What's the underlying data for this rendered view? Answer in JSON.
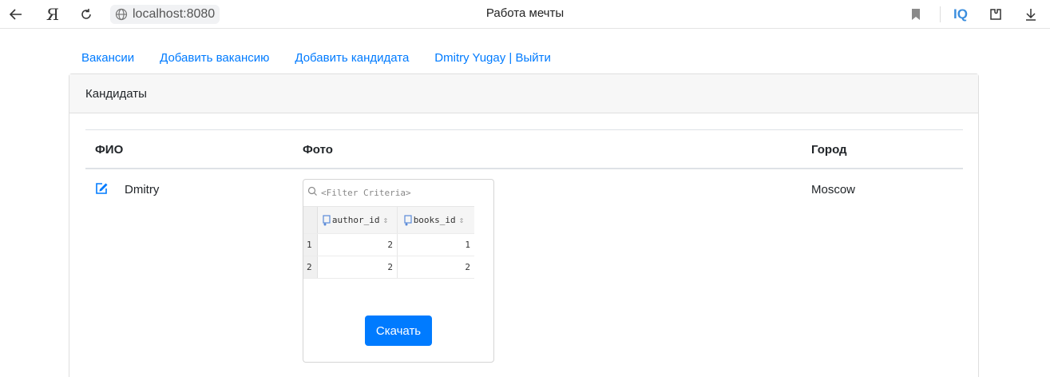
{
  "browser": {
    "address": "localhost:8080",
    "title": "Работа мечты",
    "ya_label": "Я",
    "iq_label": "IQ"
  },
  "nav": {
    "items": [
      {
        "label": "Вакансии"
      },
      {
        "label": "Добавить вакансию"
      },
      {
        "label": "Добавить кандидата"
      },
      {
        "label": "Dmitry Yugay | Выйти"
      }
    ]
  },
  "card": {
    "header": "Кандидаты",
    "columns": {
      "name": "ФИО",
      "photo": "Фото",
      "city": "Город"
    },
    "rows": [
      {
        "name": "Dmitry",
        "city": "Moscow",
        "photo_content": {
          "filter_placeholder": "<Filter Criteria>",
          "columns": [
            "author_id",
            "books_id"
          ],
          "rows": [
            {
              "num": "1",
              "author_id": "2",
              "books_id": "1"
            },
            {
              "num": "2",
              "author_id": "2",
              "books_id": "2"
            }
          ]
        },
        "download_label": "Скачать"
      }
    ]
  },
  "colors": {
    "link": "#007bff",
    "button": "#007bff",
    "iq": "#3b8ede"
  },
  "icons": {
    "back": "arrow-left-icon",
    "reload": "reload-icon",
    "site": "globe-icon",
    "bookmark": "bookmark-icon",
    "extensions": "extensions-icon",
    "download": "download-icon",
    "edit": "edit-icon",
    "search": "search-icon",
    "column": "key-column-icon"
  }
}
